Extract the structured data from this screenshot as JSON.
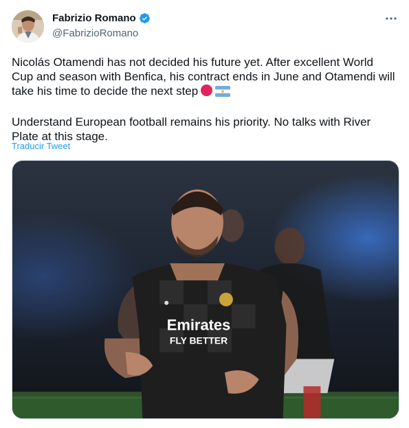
{
  "tweet": {
    "author": {
      "display_name": "Fabrizio Romano",
      "handle": "@FabrizioRomano",
      "verified": true
    },
    "text_paragraphs": [
      "Nicolás Otamendi has not decided his future yet. After excellent World Cup and season with Benfica, his contract ends in June and Otamendi will take his time to decide the next step",
      "Understand European football remains his priority. No talks with River Plate at this stage."
    ],
    "emojis": [
      "red-circle",
      "argentina-flag"
    ],
    "translate_label": "Traducir Tweet",
    "media": {
      "jersey_sponsor_line1": "Emirates",
      "jersey_sponsor_line2": "FLY BETTER"
    }
  },
  "colors": {
    "link": "#1d9bf0",
    "verified": "#1d9bf0",
    "text": "#0f1419",
    "secondary": "#536471"
  }
}
